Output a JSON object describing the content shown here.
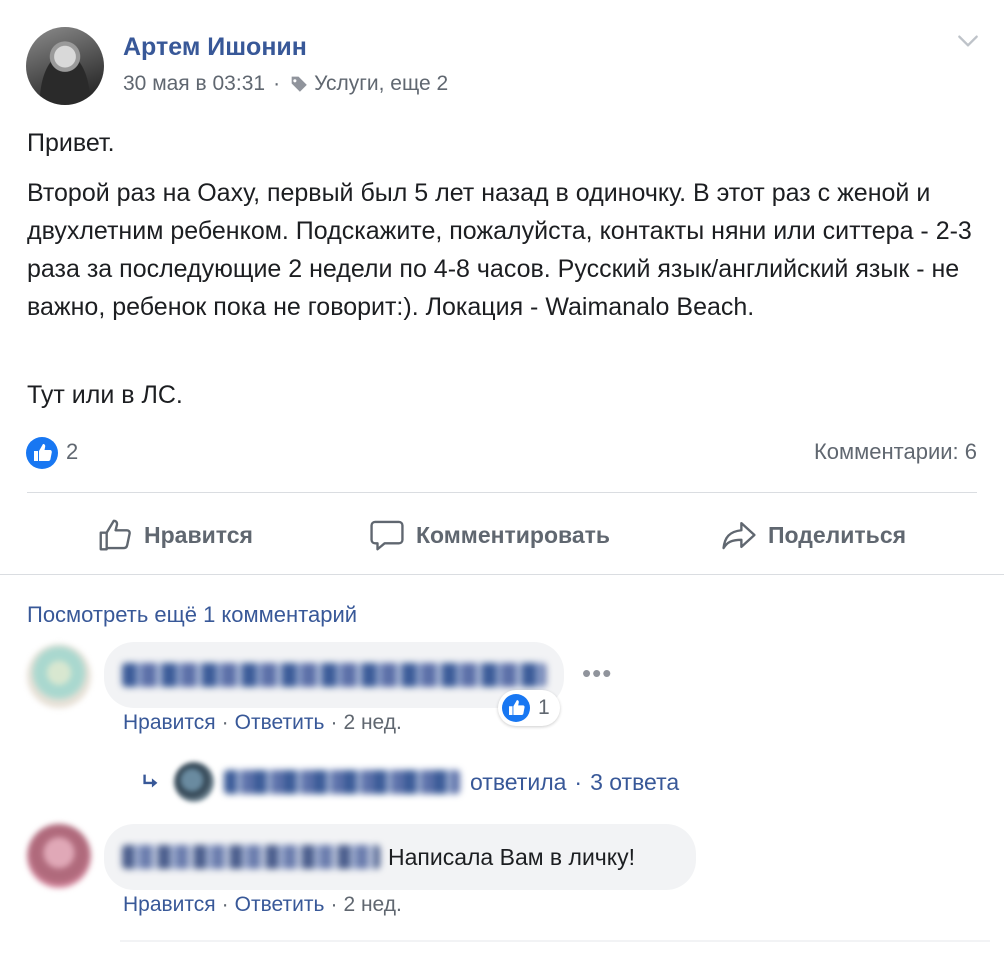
{
  "post": {
    "author": "Артем Ишонин",
    "date": "30 мая в 03:31",
    "separator": "·",
    "tags": "Услуги, еще 2",
    "paragraphs": [
      "Привет.",
      "Второй раз на Оаху, первый был 5 лет назад в одиночку. В этот раз с женой и двухлетним ребенком. Подскажите, пожалуйста, контакты няни или ситтера - 2-3 раза за последующие 2 недели по 4-8 часов. Русский язык/английский язык - не важно, ребенок пока не говорит:). Локация - Waimanalo Beach.",
      "Тут или в ЛС."
    ],
    "like_count": "2",
    "comments_count": "Комментарии: 6"
  },
  "actions": {
    "like": "Нравится",
    "comment": "Комментировать",
    "share": "Поделиться"
  },
  "comments": {
    "view_more": "Посмотреть ещё 1 комментарий",
    "c1": {
      "dots": "•••",
      "reaction_count": "1",
      "like": "Нравится",
      "reply": "Ответить",
      "time": "2 нед.",
      "sep": "·"
    },
    "replies": {
      "verb": "ответила",
      "sep": "·",
      "count": "3 ответа"
    },
    "c2": {
      "text": "Написала Вам в личку!",
      "like": "Нравится",
      "reply": "Ответить",
      "time": "2 нед.",
      "sep": "·"
    }
  },
  "colors": {
    "link": "#385898",
    "secondary": "#606770",
    "like_blue": "#1877f2",
    "bubble": "#f2f3f5"
  },
  "icons": [
    "chevron-down-icon",
    "tag-icon",
    "like-badge-icon",
    "thumbs-up-icon",
    "comment-icon",
    "share-icon",
    "reply-arrow-icon"
  ]
}
